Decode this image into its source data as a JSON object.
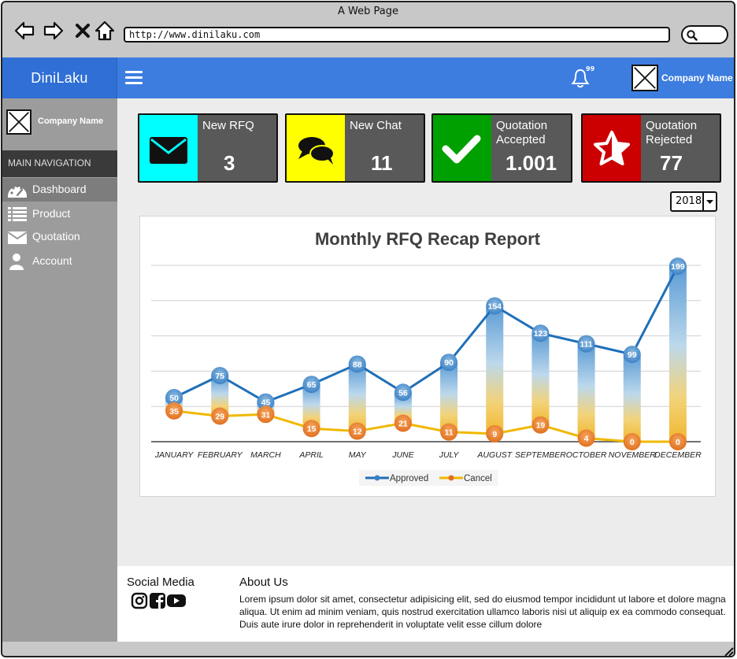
{
  "browser": {
    "window_title": "A Web Page",
    "url": "http://www.dinilaku.com"
  },
  "header": {
    "brand": "DiniLaku",
    "notification_count": "99",
    "company_name": "Company Name"
  },
  "sidebar": {
    "company_name": "Company Name",
    "section_title": "MAIN NAVIGATION",
    "items": [
      {
        "label": "Dashboard",
        "icon": "dashboard-icon",
        "active": true
      },
      {
        "label": "Product",
        "icon": "list-icon"
      },
      {
        "label": "Quotation",
        "icon": "envelope-icon"
      },
      {
        "label": "Account",
        "icon": "user-icon"
      }
    ]
  },
  "cards": [
    {
      "title": "New RFQ",
      "value": "3",
      "color": "#00ffff",
      "icon": "envelope-icon"
    },
    {
      "title": "New Chat",
      "value": "11",
      "color": "#ffff00",
      "icon": "chat-icon"
    },
    {
      "title": "Quotation Accepted",
      "title1": "Quotation",
      "title2": "Accepted",
      "value": "1.001",
      "color": "#00a000",
      "icon": "checkmark-icon"
    },
    {
      "title": "Quotation Rejected",
      "title1": "Quotation",
      "title2": "Rejected",
      "value": "77",
      "color": "#cc0000",
      "icon": "star-icon"
    }
  ],
  "year_filter": {
    "selected": "2018"
  },
  "chart_data": {
    "type": "line",
    "title": "Monthly RFQ Recap Report",
    "categories": [
      "JANUARY",
      "FEBRUARY",
      "MARCH",
      "APRIL",
      "MAY",
      "JUNE",
      "JULY",
      "AUGUST",
      "SEPTEMBER",
      "OCTOBER",
      "NOVEMBER",
      "DECEMBER"
    ],
    "series": [
      {
        "name": "Approved",
        "values": [
          50,
          75,
          45,
          65,
          88,
          56,
          90,
          154,
          123,
          111,
          99,
          199
        ],
        "color": "#1f6fb8"
      },
      {
        "name": "Cancel",
        "values": [
          35,
          29,
          31,
          15,
          12,
          21,
          11,
          9,
          19,
          4,
          0,
          0
        ],
        "color": "#f0b800"
      }
    ],
    "ylim": [
      0,
      200
    ],
    "grid": true,
    "legend": "bottom"
  },
  "footer": {
    "social_title": "Social Media",
    "social_icons": [
      "instagram-icon",
      "facebook-icon",
      "youtube-icon"
    ],
    "about_title": "About Us",
    "about_text": "Lorem ipsum dolor sit amet, consectetur adipisicing elit, sed do eiusmod tempor incididunt ut labore et dolore magna aliqua. Ut enim ad minim veniam, quis nostrud exercitation ullamco laboris nisi ut aliquip ex ea commodo consequat. Duis aute irure dolor in reprehenderit in voluptate velit esse cillum dolore"
  }
}
